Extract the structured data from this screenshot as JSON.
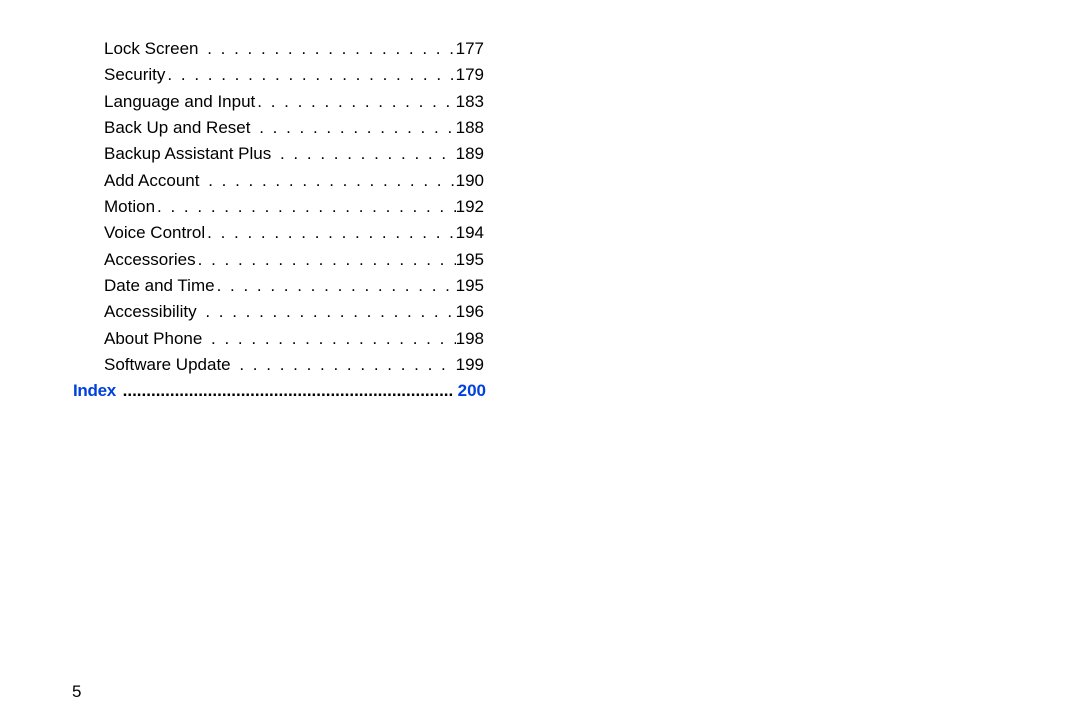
{
  "toc": {
    "entries": [
      {
        "label": "Lock Screen",
        "page": "177"
      },
      {
        "label": "Security",
        "page": "179"
      },
      {
        "label": "Language and Input",
        "page": "183"
      },
      {
        "label": "Back Up and Reset",
        "page": "188"
      },
      {
        "label": "Backup Assistant Plus",
        "page": "189"
      },
      {
        "label": "Add Account",
        "page": "190"
      },
      {
        "label": "Motion",
        "page": "192"
      },
      {
        "label": "Voice Control",
        "page": "194"
      },
      {
        "label": "Accessories",
        "page": "195"
      },
      {
        "label": "Date and Time",
        "page": "195"
      },
      {
        "label": "Accessibility",
        "page": "196"
      },
      {
        "label": "About Phone",
        "page": "198"
      },
      {
        "label": "Software Update",
        "page": "199"
      }
    ],
    "index": {
      "label": "Index",
      "page": "200"
    }
  },
  "footer": {
    "page_number": "5"
  }
}
